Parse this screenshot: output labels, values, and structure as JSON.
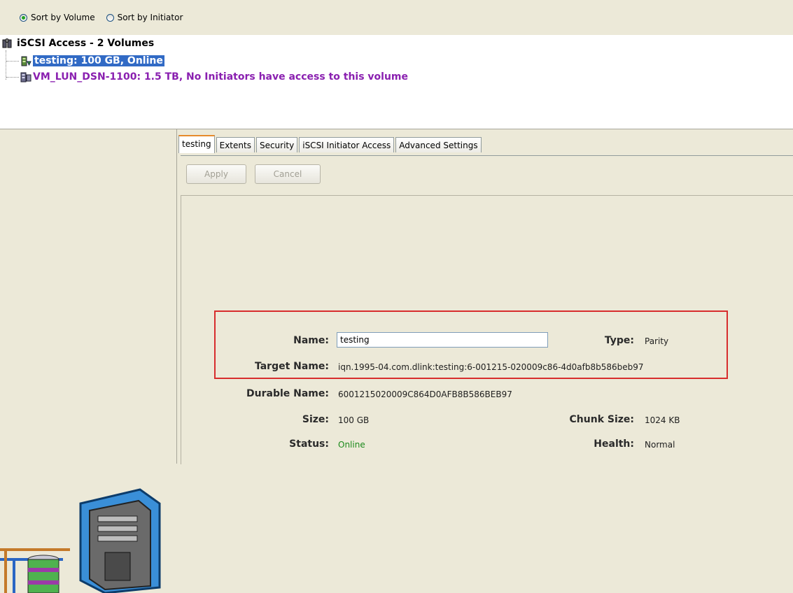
{
  "sort_options": [
    {
      "label": "Sort by Volume",
      "selected": true
    },
    {
      "label": "Sort by Initiator",
      "selected": false
    }
  ],
  "tree": {
    "root": "iSCSI Access - 2 Volumes",
    "items": [
      {
        "label": "testing: 100 GB, Online",
        "selected": true
      },
      {
        "label": "VM_LUN_DSN-1100: 1.5 TB, No Initiators have access to this volume",
        "selected": false
      }
    ]
  },
  "tabs": [
    "testing",
    "Extents",
    "Security",
    "iSCSI Initiator Access",
    "Advanced Settings"
  ],
  "active_tab": "testing",
  "buttons": {
    "apply": "Apply",
    "cancel": "Cancel"
  },
  "details": {
    "name_label": "Name:",
    "name_value": "testing",
    "type_label": "Type:",
    "type_value": "Parity",
    "target_label": "Target Name:",
    "target_value": "iqn.1995-04.com.dlink:testing:6-001215-020009c86-4d0afb8b586beb97",
    "durable_label": "Durable Name:",
    "durable_value": "6001215020009C864D0AFB8B586BEB97",
    "size_label": "Size:",
    "size_value": "100 GB",
    "chunk_label": "Chunk Size:",
    "chunk_value": "1024 KB",
    "status_label": "Status:",
    "status_value": "Online",
    "health_label": "Health:",
    "health_value": "Normal"
  },
  "colors": {
    "status_online": "#1b8a1b",
    "highlight_border": "#d72d2d",
    "selection": "#316ac5",
    "warning_volume": "#8a20b0"
  }
}
